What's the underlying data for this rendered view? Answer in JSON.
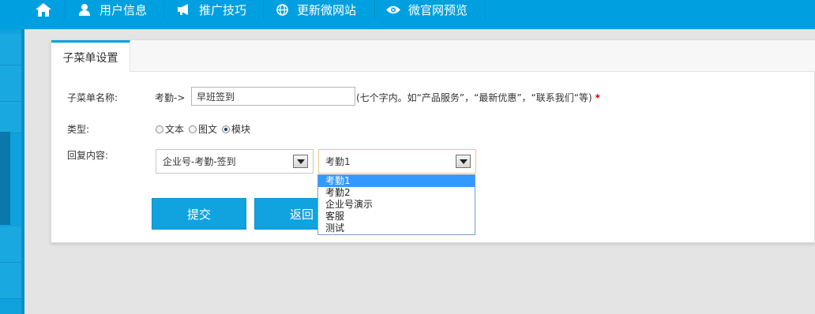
{
  "nav": {
    "home_icon": "home-icon",
    "items": [
      {
        "icon": "user-icon",
        "label": "用户信息"
      },
      {
        "icon": "megaphone-icon",
        "label": "推广技巧"
      },
      {
        "icon": "globe-icon",
        "label": "更新微网站"
      },
      {
        "icon": "eye-icon",
        "label": "微官网预览"
      }
    ]
  },
  "tab": {
    "label": "子菜单设置"
  },
  "form": {
    "name_label": "子菜单名称:",
    "name_prefix": "考勤->",
    "name_value": "早班签到",
    "name_hint": "(七个字内。如“产品服务”，“最新优惠”，“联系我们“等)",
    "required_mark": "*",
    "type_label": "类型:",
    "type_options": [
      "文本",
      "图文",
      "模块"
    ],
    "type_selected": "模块",
    "reply_label": "回复内容:",
    "reply_select_1": "企业号-考勤-签到",
    "reply_select_2": "考勤1",
    "reply_select_2_options": [
      "考勤1",
      "考勤2",
      "企业号演示",
      "客服",
      "测试"
    ],
    "submit_label": "提交",
    "back_label": "返回"
  },
  "colors": {
    "accent": "#00a0e0",
    "button": "#11a3df",
    "required": "#d10000",
    "option_highlight": "#3399ff"
  }
}
